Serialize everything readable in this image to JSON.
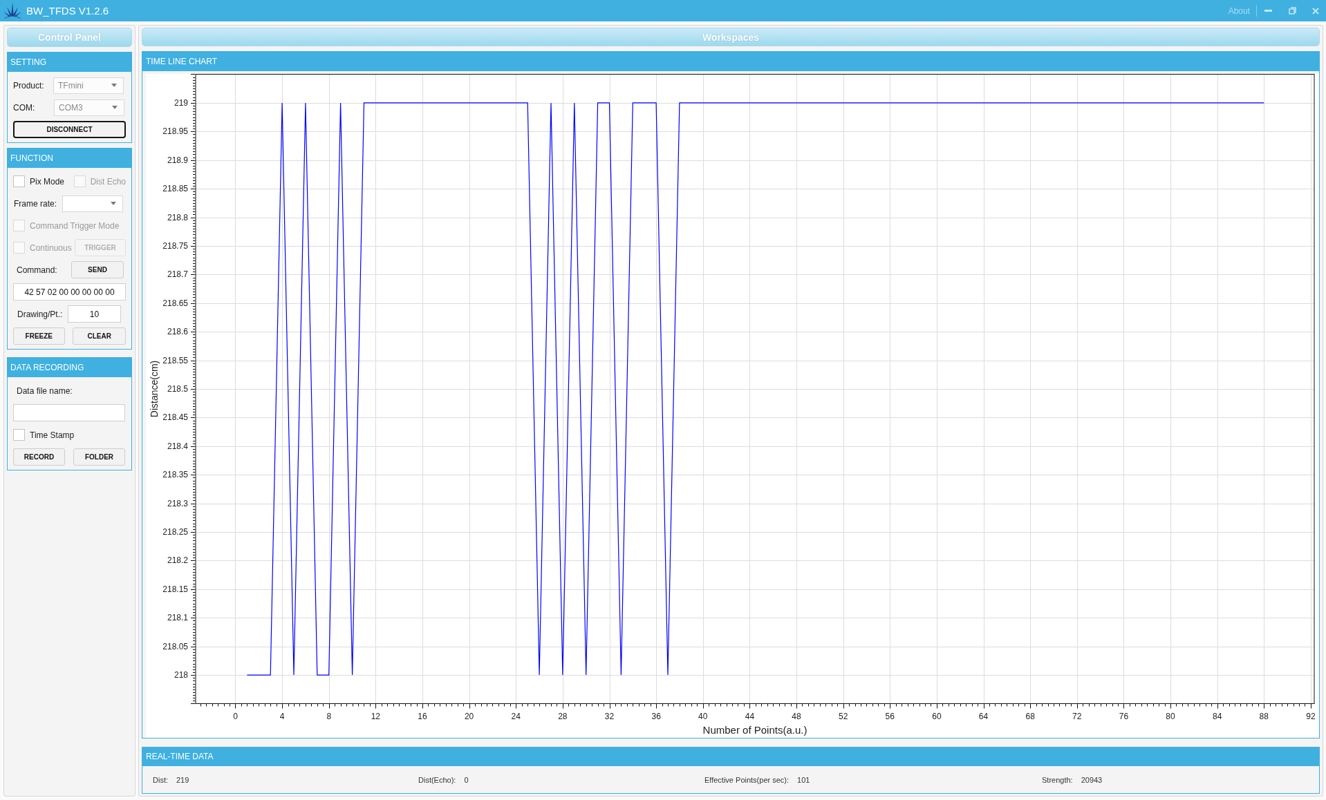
{
  "window": {
    "title": "BW_TFDS V1.2.6",
    "about": "About"
  },
  "control_panel": {
    "title": "Control Panel",
    "setting": {
      "title": "SETTING",
      "product": {
        "label": "Product:",
        "value": "TFmini",
        "disabled": true
      },
      "com": {
        "label": "COM:",
        "value": "COM3",
        "disabled": true
      },
      "connect_button": {
        "label": "DISCONNECT",
        "focused": true,
        "disabled": false
      }
    },
    "function": {
      "title": "FUNCTION",
      "pix_mode": {
        "label": "Pix Mode",
        "checked": false,
        "disabled": false
      },
      "dist_echo": {
        "label": "Dist Echo",
        "checked": false,
        "disabled": true
      },
      "frame_rate": {
        "label": "Frame rate:"
      },
      "command_trigger_mode": {
        "label": "Command Trigger Mode",
        "checked": false,
        "disabled": true
      },
      "continuous": {
        "label": "Continuous",
        "checked": false,
        "disabled": true
      },
      "trigger_button": {
        "label": "TRIGGER",
        "focused": false,
        "disabled": true
      },
      "command": {
        "label": "Command:",
        "value": "42 57 02 00 00 00 00 00"
      },
      "send_button": {
        "label": "SEND",
        "focused": false,
        "disabled": false
      },
      "drawing_per_point": {
        "label": "Drawing/Pt.:",
        "value": "10"
      },
      "freeze_button": {
        "label": "FREEZE",
        "focused": false,
        "disabled": false
      },
      "clear_button": {
        "label": "CLEAR",
        "focused": false,
        "disabled": false
      }
    },
    "data_recording": {
      "title": "DATA RECORDING",
      "file_name": {
        "label": "Data file name:"
      },
      "time_stamp": {
        "label": "Time Stamp",
        "checked": false,
        "disabled": false
      },
      "record_button": {
        "label": "RECORD",
        "focused": false,
        "disabled": false
      },
      "folder_button": {
        "label": "FOLDER",
        "focused": false,
        "disabled": false
      }
    }
  },
  "workspaces": {
    "title": "Workspaces",
    "time_line_chart": {
      "title": "TIME LINE CHART",
      "chart_data": {
        "type": "line",
        "xlabel": "Number of Points(a.u.)",
        "ylabel": "Distance(cm)",
        "x": [
          1,
          2,
          3,
          4,
          5,
          6,
          7,
          8,
          9,
          10,
          11,
          12,
          13,
          14,
          15,
          16,
          17,
          18,
          19,
          20,
          21,
          22,
          23,
          24,
          25,
          26,
          27,
          28,
          29,
          30,
          31,
          32,
          33,
          34,
          35,
          36,
          37,
          38,
          39,
          40,
          41,
          42,
          43,
          44,
          45,
          46,
          47,
          48,
          49,
          50,
          51,
          52,
          53,
          54,
          55,
          56,
          57,
          58,
          59,
          60,
          61,
          62,
          63,
          64,
          65,
          66,
          67,
          68,
          69,
          70,
          71,
          72,
          73,
          74,
          75,
          76,
          77,
          78,
          79,
          80,
          81,
          82,
          83,
          84,
          85,
          86,
          87,
          88
        ],
        "series": [
          {
            "color": "#0000ff",
            "values": [
              218,
              218,
              218,
              219,
              218,
              219,
              218,
              218,
              219,
              218,
              219,
              219,
              219,
              219,
              219,
              219,
              219,
              219,
              219,
              219,
              219,
              219,
              219,
              219,
              219,
              218,
              219,
              218,
              219,
              218,
              219,
              219,
              218,
              219,
              219,
              219,
              218,
              219,
              219,
              219,
              219,
              219,
              219,
              219,
              219,
              219,
              219,
              219,
              219,
              219,
              219,
              219,
              219,
              219,
              219,
              219,
              219,
              219,
              219,
              219,
              219,
              219,
              219,
              219,
              219,
              219,
              219,
              219,
              219,
              219,
              219,
              219,
              219,
              219,
              219,
              219,
              219,
              219,
              219,
              219,
              219,
              219,
              219,
              219,
              219,
              219,
              219,
              219
            ]
          }
        ],
        "xlim": [
          -3.4,
          92.3
        ],
        "ylim": [
          217.95,
          219.05
        ],
        "xticks": [
          0,
          4,
          8,
          12,
          16,
          20,
          24,
          28,
          32,
          36,
          40,
          44,
          48,
          52,
          56,
          60,
          64,
          68,
          72,
          76,
          80,
          84,
          88,
          92
        ],
        "yticks": [
          218,
          218.05,
          218.1,
          218.15,
          218.2,
          218.25,
          218.3,
          218.35,
          218.4,
          218.45,
          218.5,
          218.55,
          218.6,
          218.65,
          218.7,
          218.75,
          218.8,
          218.85,
          218.9,
          218.95,
          219
        ],
        "grid": true
      }
    },
    "real_time_data": {
      "title": "REAL-TIME DATA",
      "fields": [
        {
          "label": "Dist:",
          "value": "219"
        },
        {
          "label": "Dist(Echo):",
          "value": "0"
        },
        {
          "label": "Effective Points(per sec):",
          "value": "101"
        },
        {
          "label": "Strength:",
          "value": "20943"
        }
      ]
    }
  }
}
